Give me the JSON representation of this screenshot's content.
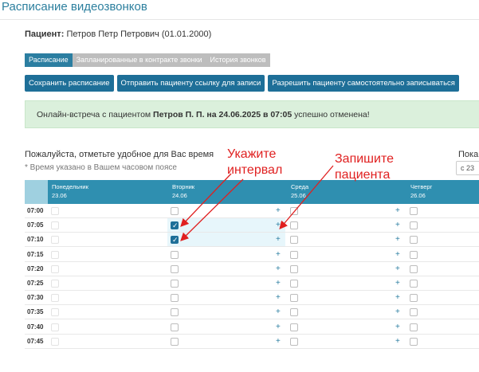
{
  "page_title": "Расписание видеозвонков",
  "patient": {
    "label": "Пациент:",
    "value": "Петров Петр Петрович (01.01.2000)"
  },
  "tabs": [
    {
      "label": "Расписание",
      "active": true
    },
    {
      "label": "Запланированные в контракте звонки",
      "active": false
    },
    {
      "label": "История звонков",
      "active": false
    }
  ],
  "buttons": {
    "save": "Сохранить расписание",
    "send_link": "Отправить пациенту ссылку для записи",
    "allow_self": "Разрешить пациенту самостоятельно записываться"
  },
  "alert": {
    "prefix": "Онлайн-встреча с пациентом ",
    "bold": "Петров П. П. на 24.06.2025 в 07:05",
    "suffix": " успешно отменена!"
  },
  "prompt": "Пожалуйста, отметьте удобное для Вас время",
  "timezone_note": "* Время указано в Вашем часовом поясе",
  "show": {
    "label": "Пока",
    "select_value": "с 23"
  },
  "days": [
    {
      "name": "Понедельник",
      "date": "23.06"
    },
    {
      "name": "Вторник",
      "date": "24.06"
    },
    {
      "name": "Среда",
      "date": "25.06"
    },
    {
      "name": "Четверг",
      "date": "26.06"
    }
  ],
  "times": [
    "07:00",
    "07:05",
    "07:10",
    "07:15",
    "07:20",
    "07:25",
    "07:30",
    "07:35",
    "07:40",
    "07:45"
  ],
  "checked_tuesday": [
    "07:05",
    "07:10"
  ],
  "annotations": {
    "interval": [
      "Укажите",
      "интервал"
    ],
    "record": [
      "Запишите",
      "пациента"
    ]
  },
  "colors": {
    "accent": "#2b7ea1",
    "header": "#2f8fb0",
    "annotation": "#e02020",
    "alert_bg": "#dbf0dc"
  }
}
